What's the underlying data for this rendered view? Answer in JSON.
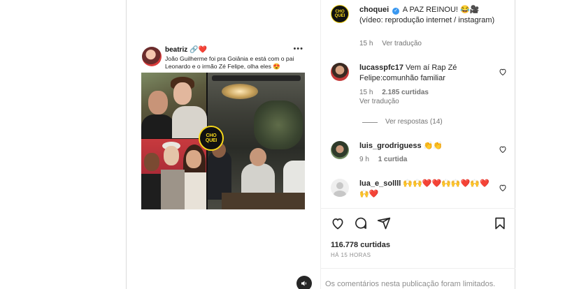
{
  "embedded_post": {
    "username": "beatriz",
    "username_suffix": "🔗❤️",
    "more_label": "•••",
    "caption": "João Guilherme foi pra Goiânia e está com o pai Leonardo e o irmão Zé Felipe, olha eles 😍",
    "badge_text": "CHO QUEI"
  },
  "post": {
    "author": "choquei",
    "caption": "A PAZ REINOU! 😂🎥 (vídeo: reprodução internet / instagram)",
    "time": "15 h",
    "translate_label": "Ver tradução",
    "avatar_text": "CHO QUEI"
  },
  "comments": [
    {
      "username": "lucasspfc17",
      "text": "Vem aí Rap Zé Felipe:comunhão familiar",
      "time": "15 h",
      "likes": "2.185 curtidas",
      "translate_label": "Ver tradução",
      "replies_label": "Ver respostas (14)"
    },
    {
      "username": "luis_grodriguess",
      "text": "👏👏",
      "time": "9 h",
      "likes": "1 curtida"
    },
    {
      "username": "lua_e_sollll",
      "text": "🙌🙌❤️❤️🙌🙌❤️🙌❤️🙌❤️"
    }
  ],
  "footer": {
    "likes": "116.778 curtidas",
    "time": "HÁ 15 HORAS",
    "limited_notice": "Os comentários nesta publicação foram limitados."
  },
  "colors": {
    "verified": "#3897f0",
    "brand_yellow": "#f7d81b",
    "muted_text": "#737373"
  }
}
